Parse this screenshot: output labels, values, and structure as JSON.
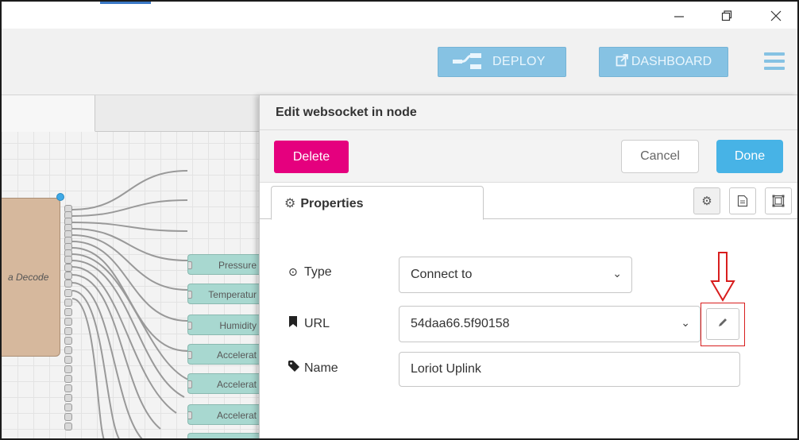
{
  "window": {
    "controls": {
      "minimize": "minimize-icon",
      "maximize": "restore-icon",
      "close": "close-icon"
    }
  },
  "header": {
    "deploy_label": "DEPLOY",
    "dashboard_label": "DASHBOARD",
    "accent_color": "#86c2e3"
  },
  "workspace": {
    "decode_node_label": "a Decode",
    "output_nodes": [
      "Pressure",
      "Temperatur",
      "Humidity",
      "Accelerat",
      "Accelerat",
      "Accelerat",
      ""
    ]
  },
  "panel": {
    "title": "Edit websocket in node",
    "delete_label": "Delete",
    "cancel_label": "Cancel",
    "done_label": "Done",
    "tab_properties": "Properties",
    "colors": {
      "delete": "#e5007e",
      "done": "#47b3e6",
      "highlight": "#d81e1e"
    },
    "form": {
      "type_label": "Type",
      "type_value": "Connect to",
      "url_label": "URL",
      "url_value": "54daa66.5f90158",
      "name_label": "Name",
      "name_value": "Loriot Uplink"
    }
  }
}
